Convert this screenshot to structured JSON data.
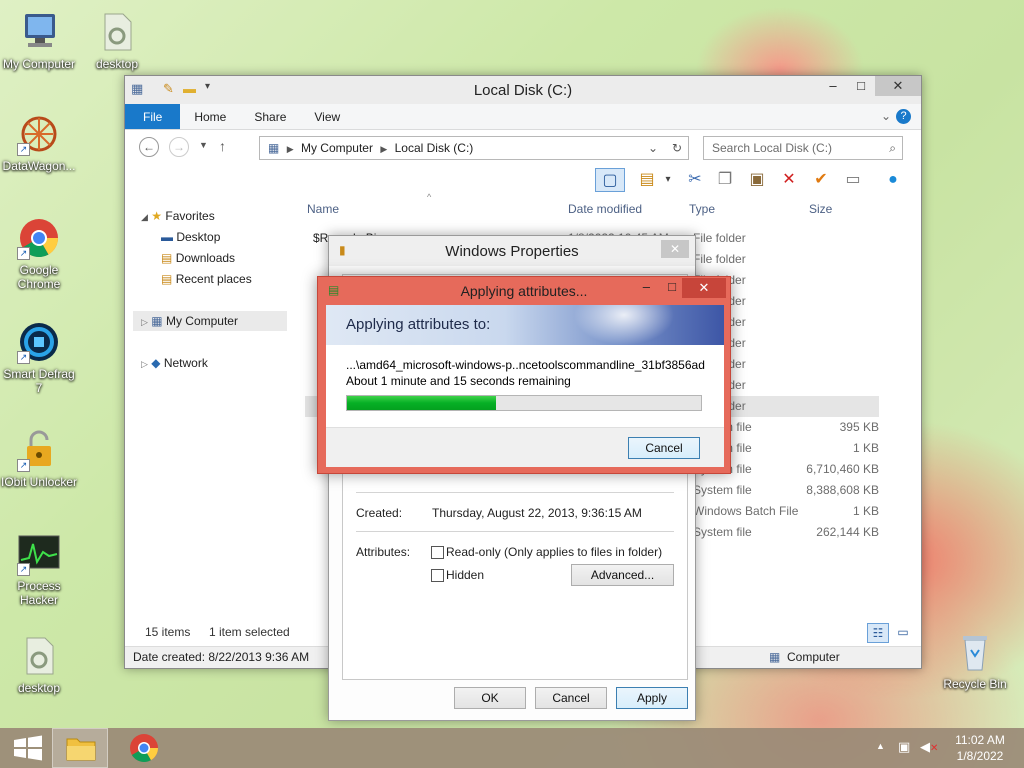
{
  "desktop": {
    "icons": [
      {
        "label": "My Computer"
      },
      {
        "label": "desktop"
      },
      {
        "label": "DataWagon..."
      },
      {
        "label": "Google Chrome"
      },
      {
        "label": "Smart Defrag 7"
      },
      {
        "label": "IObit Unlocker"
      },
      {
        "label": "Process Hacker"
      },
      {
        "label": "desktop"
      },
      {
        "label": "Recycle Bin"
      }
    ]
  },
  "explorer": {
    "title": "Local Disk (C:)",
    "tabs": [
      "File",
      "Home",
      "Share",
      "View"
    ],
    "address": {
      "segment1": "My Computer",
      "segment2": "Local Disk (C:)"
    },
    "search_placeholder": "Search Local Disk (C:)",
    "nav": {
      "favorites": "Favorites",
      "desktop": "Desktop",
      "downloads": "Downloads",
      "recent": "Recent places",
      "my_computer": "My Computer",
      "network": "Network"
    },
    "columns": {
      "name": "Name",
      "date": "Date modified",
      "type": "Type",
      "size": "Size"
    },
    "rows": [
      {
        "name": "$Recycle.Bin",
        "date": "1/8/2022 10:45 AM",
        "type": "File folder",
        "size": ""
      },
      {
        "name": "",
        "date": "",
        "type": "File folder",
        "size": ""
      },
      {
        "name": "",
        "date": "",
        "type": "File folder",
        "size": ""
      },
      {
        "name": "",
        "date": "",
        "type": "File folder",
        "size": ""
      },
      {
        "name": "",
        "date": "",
        "type": "File folder",
        "size": ""
      },
      {
        "name": "",
        "date": "",
        "type": "File folder",
        "size": ""
      },
      {
        "name": "",
        "date": "",
        "type": "File folder",
        "size": ""
      },
      {
        "name": "",
        "date": "",
        "type": "File folder",
        "size": ""
      },
      {
        "name": "",
        "date": "",
        "type": "File folder",
        "size": ""
      },
      {
        "name": "",
        "date": "",
        "type": "System file",
        "size": "395 KB"
      },
      {
        "name": "",
        "date": "",
        "type": "System file",
        "size": "1 KB"
      },
      {
        "name": "",
        "date": "",
        "type": "System file",
        "size": "6,710,460 KB"
      },
      {
        "name": "",
        "date": "",
        "type": "System file",
        "size": "8,388,608 KB"
      },
      {
        "name": "",
        "date": "",
        "type": "Windows Batch File",
        "size": "1 KB"
      },
      {
        "name": "",
        "date": "",
        "type": "System file",
        "size": "262,144 KB"
      }
    ],
    "status": {
      "items": "15 items",
      "selected": "1 item selected"
    },
    "bottom": {
      "date_created": "Date created: 8/22/2013 9:36 AM",
      "location": "Computer"
    }
  },
  "properties": {
    "title": "Windows Properties",
    "created_label": "Created:",
    "created_value": "Thursday, August 22, 2013, 9:36:15 AM",
    "attributes_label": "Attributes:",
    "readonly_label": "Read-only (Only applies to files in folder)",
    "hidden_label": "Hidden",
    "advanced_button": "Advanced...",
    "ok_button": "OK",
    "cancel_button": "Cancel",
    "apply_button": "Apply"
  },
  "applying": {
    "title": "Applying attributes...",
    "heading": "Applying attributes to:",
    "path": "...\\amd64_microsoft-windows-p..ncetoolscommandline_31bf3856ad",
    "remaining": "About 1 minute and 15 seconds remaining",
    "progress_fraction": 0.42,
    "cancel_button": "Cancel"
  },
  "taskbar": {
    "time": "11:02 AM",
    "date": "1/8/2022"
  },
  "colors": {
    "accent": "#1979ca",
    "dialog_frame": "#e66a5b",
    "progress": "#06b025",
    "taskbar": "#9a8a76"
  }
}
